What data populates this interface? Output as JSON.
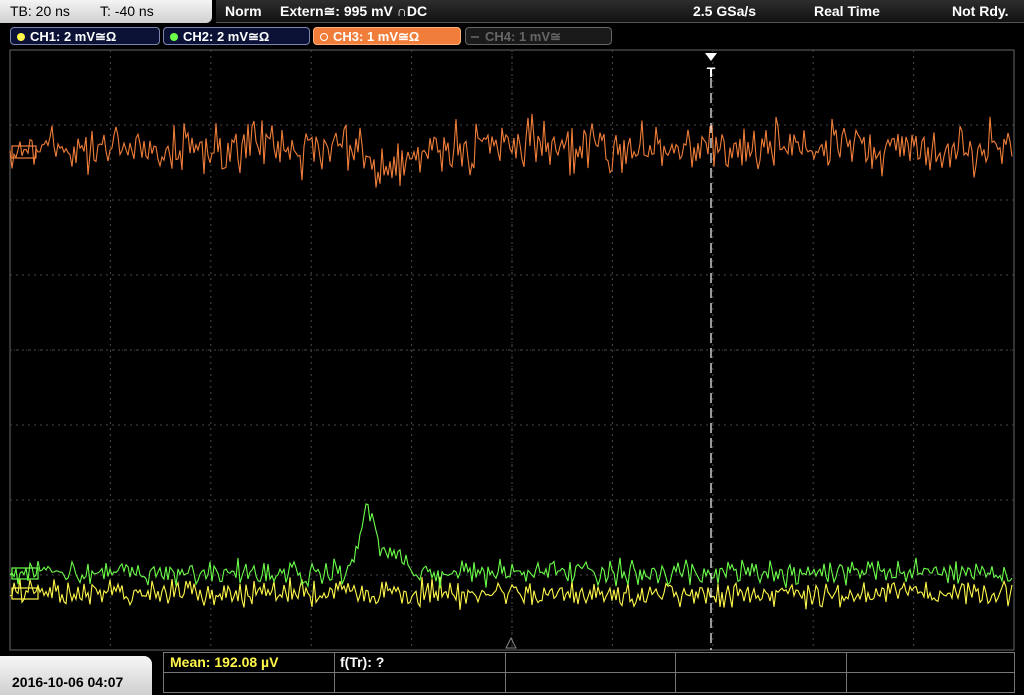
{
  "header": {
    "timebase": "TB: 20 ns",
    "trigger_time": "T: -40 ns",
    "acq_mode": "Norm",
    "trigger_source": "Extern≅: 995 mV ∩DC",
    "sample_rate": "2.5 GSa/s",
    "acq_type": "Real Time",
    "status": "Not Rdy."
  },
  "channels": [
    {
      "label": "CH1: 2 mV≅Ω",
      "color": "#fff84a",
      "active": true
    },
    {
      "label": "CH2: 2 mV≅Ω",
      "color": "#6cff4a",
      "active": true
    },
    {
      "label": "CH3: 1 mV≅Ω",
      "color": "#f07e3a",
      "active": true,
      "selected": true
    },
    {
      "label": "CH4: 1 mV≅",
      "color": "#666666",
      "active": false
    }
  ],
  "trigger_marker": "T",
  "measurements": {
    "mean_label": "Mean: 192.08 µV",
    "freq_label": "f(Tr): ?"
  },
  "datetime": "2016-10-06 04:07",
  "colors": {
    "ch1": "#fff84a",
    "ch2": "#6cff4a",
    "ch3": "#f07e3a",
    "grid": "#4a4a4a",
    "background": "#000000"
  }
}
